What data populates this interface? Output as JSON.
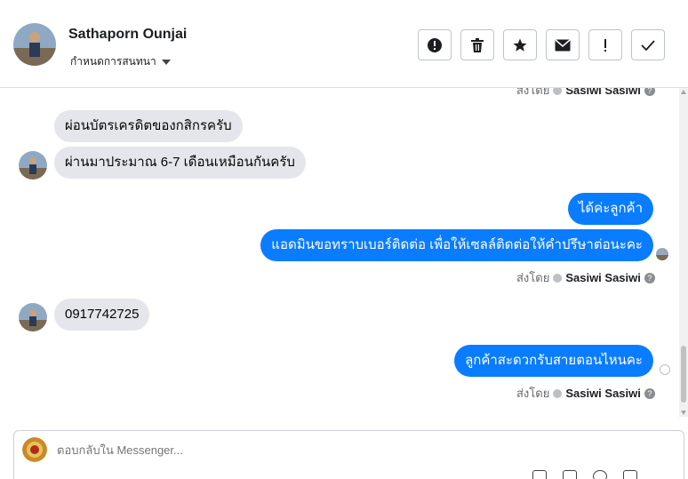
{
  "header": {
    "contact_name": "Sathaporn Ounjai",
    "assign_label": "กำหนดการสนทนา",
    "actions": [
      {
        "name": "spam-button",
        "icon": "alert-circle-icon"
      },
      {
        "name": "delete-button",
        "icon": "trash-icon"
      },
      {
        "name": "star-button",
        "icon": "star-icon"
      },
      {
        "name": "mark-unread-button",
        "icon": "envelope-icon"
      },
      {
        "name": "follow-up-button",
        "icon": "exclamation-icon"
      },
      {
        "name": "mark-done-button",
        "icon": "checkmark-icon"
      }
    ]
  },
  "chat": {
    "sent_by_prefix": "ส่งโดย",
    "sent_by_name": "Sasiwi Sasiwi",
    "messages": [
      {
        "dir": "in",
        "text": "ผ่อนบัตรเครดิตของกสิกรครับ"
      },
      {
        "dir": "in",
        "text": "ผ่านมาประมาณ 6-7 เดือนเหมือนกันครับ"
      },
      {
        "dir": "out",
        "text": "ได้ค่ะลูกค้า"
      },
      {
        "dir": "out",
        "text": "แอดมินขอทราบเบอร์ติดต่อ เพื่อให้เซลล์ติดต่อให้คำปรึษาต่อนะคะ"
      },
      {
        "dir": "in",
        "text": "0917742725"
      },
      {
        "dir": "out",
        "text": "ลูกค้าสะดวกรับสายตอนไหนคะ"
      }
    ]
  },
  "composer": {
    "placeholder": "ตอบกลับใน Messenger..."
  },
  "colors": {
    "outgoing_bubble": "#0a7cff",
    "incoming_bubble": "#e4e6eb"
  }
}
